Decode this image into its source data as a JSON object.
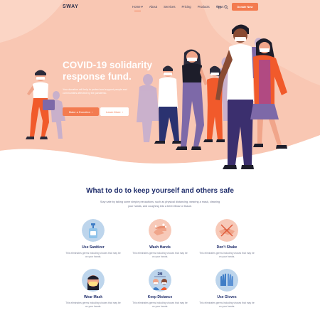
{
  "header": {
    "logo": "SWAY",
    "nav": [
      "Home",
      "About",
      "Services",
      "Pricing",
      "Products",
      "News"
    ],
    "donate_button": "Donate Now",
    "icons": [
      "cart-icon",
      "search-icon"
    ]
  },
  "hero": {
    "title_line1": "COVID-19 solidarity",
    "title_line2": "response fund.",
    "description": "Your donation will help to protect and support people and communities affected by the pandemic.",
    "primary_button": "Make a Donation",
    "secondary_button": "Learn More"
  },
  "safety": {
    "title": "What to do to keep yourself and others safe",
    "description": "Stay safe by taking some simple precautions, such as physical distancing, wearing a mask, cleaning your hands, and coughing into a bent elbow or tissue.",
    "cards": [
      {
        "title": "Use Sanitizer",
        "text": "This eliminates germs including viruses that may be on your hands.",
        "icon": "sanitizer-icon"
      },
      {
        "title": "Wash Hands",
        "text": "This eliminates germs including viruses that may be on your hands.",
        "icon": "wash-hands-icon"
      },
      {
        "title": "Don't Shake",
        "text": "This eliminates germs including viruses that may be on your hands.",
        "icon": "no-handshake-icon"
      },
      {
        "title": "Wear Mask",
        "text": "This eliminates germs including viruses that may be on your hands.",
        "icon": "mask-icon"
      },
      {
        "title": "Keep Distance",
        "text": "This eliminates germs including viruses that may be on your hands.",
        "icon": "distance-icon"
      },
      {
        "title": "Use Gloves",
        "text": "This eliminates germs including viruses that may be on your hands.",
        "icon": "gloves-icon"
      }
    ],
    "distance_badge": "2M"
  },
  "colors": {
    "hero_bg": "#f9c7b3",
    "hero_bg_light": "#fde3d8",
    "accent": "#f37b50",
    "heading": "#1f2d6b",
    "icon_bg": "#bdd5ec"
  }
}
